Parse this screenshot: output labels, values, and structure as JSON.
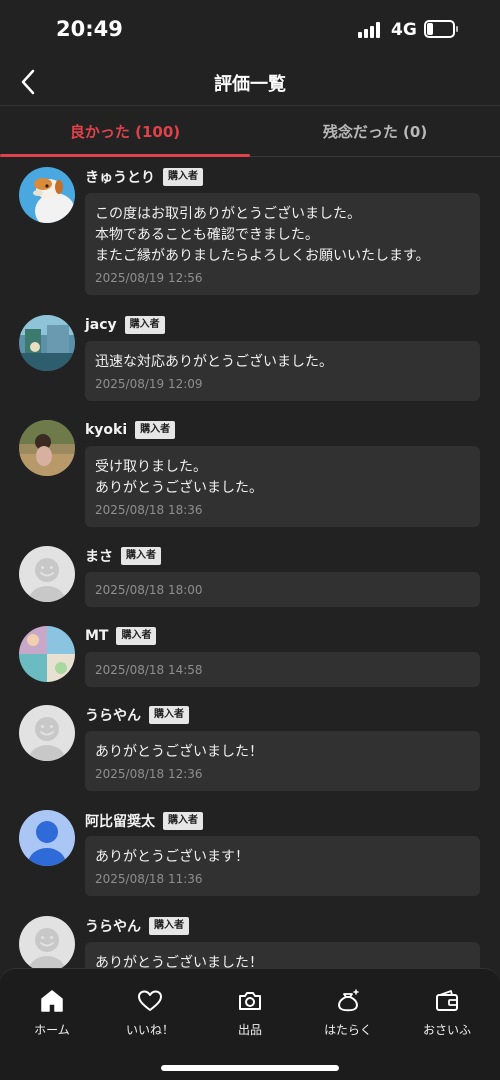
{
  "status_bar": {
    "time": "20:49",
    "network": "4G"
  },
  "header": {
    "title": "評価一覧"
  },
  "tabs": [
    {
      "label": "良かった (100)",
      "active": true
    },
    {
      "label": "残念だった (0)",
      "active": false
    }
  ],
  "buyer_badge": "購入者",
  "reviews": [
    {
      "name": "きゅうとり",
      "comment": "この度はお取引ありがとうございました。\n本物であることも確認できました。\nまたご縁がありましたらよろしくお願いいたします。",
      "date": "2025/08/19 12:56",
      "avatar": "dog-photo"
    },
    {
      "name": "jacy",
      "comment": "迅速な対応ありがとうございました。",
      "date": "2025/08/19 12:09",
      "avatar": "landscape-photo"
    },
    {
      "name": "kyoki",
      "comment": "受け取りました。\nありがとうございました。",
      "date": "2025/08/18 18:36",
      "avatar": "child-photo"
    },
    {
      "name": "まさ",
      "comment": "",
      "date": "2025/08/18 18:00",
      "avatar": "default-face"
    },
    {
      "name": "MT",
      "comment": "",
      "date": "2025/08/18 14:58",
      "avatar": "collage-photo"
    },
    {
      "name": "うらやん",
      "comment": "ありがとうございました！",
      "date": "2025/08/18 12:36",
      "avatar": "default-face"
    },
    {
      "name": "阿比留奨太",
      "comment": "ありがとうございます！",
      "date": "2025/08/18 11:36",
      "avatar": "default-person-blue"
    },
    {
      "name": "うらやん",
      "comment": "ありがとうございました！",
      "date": "",
      "avatar": "default-face"
    }
  ],
  "bottom_nav": [
    {
      "label": "ホーム",
      "icon": "home-icon"
    },
    {
      "label": "いいね！",
      "icon": "heart-icon"
    },
    {
      "label": "出品",
      "icon": "camera-icon"
    },
    {
      "label": "はたらく",
      "icon": "money-bag-icon"
    },
    {
      "label": "おさいふ",
      "icon": "wallet-icon"
    }
  ],
  "colors": {
    "accent": "#e0424c",
    "background": "#222222",
    "bubble": "#313131"
  }
}
